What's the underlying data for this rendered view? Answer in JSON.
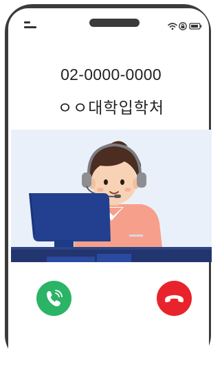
{
  "call": {
    "phone_number": "02-0000-0000",
    "caller_name": "ㅇㅇ대학입학처"
  },
  "status_bar": {
    "icons": [
      "menu-icon",
      "wifi-icon",
      "lock-icon",
      "battery-icon"
    ]
  },
  "actions": {
    "accept_icon": "phone-accept-icon",
    "decline_icon": "phone-decline-icon"
  },
  "colors": {
    "frame": "#3b3b3b",
    "accept": "#2bb466",
    "decline": "#e9232b",
    "illustration_bg": "#eaf0f9",
    "desk": "#22356f"
  }
}
